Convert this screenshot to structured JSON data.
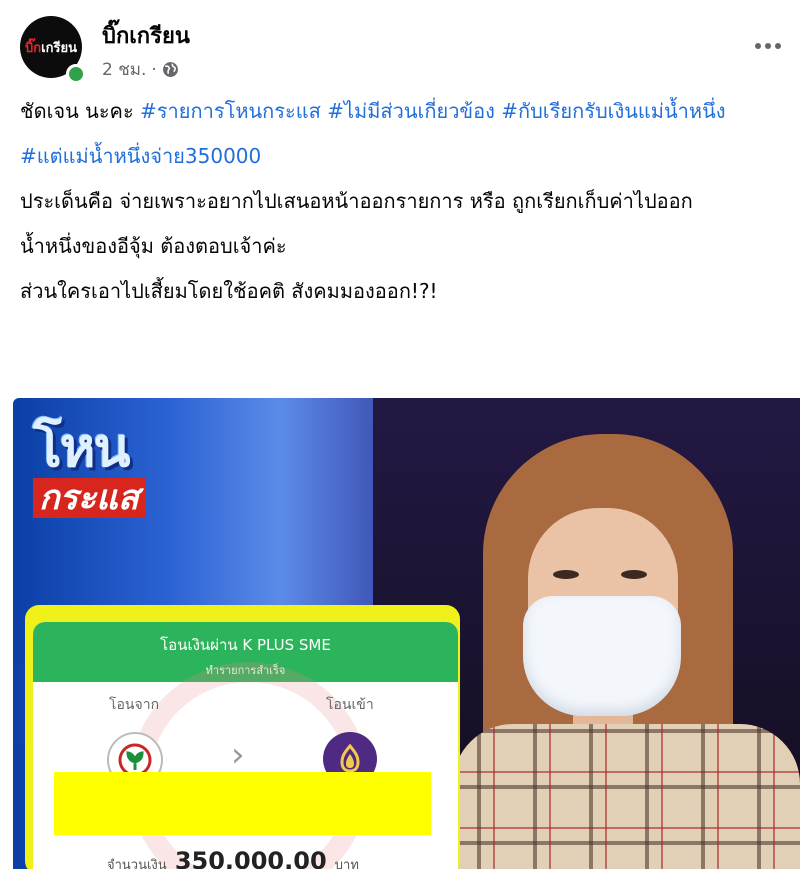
{
  "post": {
    "page_name": "บิ๊กเกรียน",
    "avatar_text_red": "บิ๊ก",
    "avatar_text_white": "เกรียน",
    "time": "2 ชม.",
    "separator": "·",
    "privacy_icon": "globe-icon",
    "more_icon": "more-options-icon"
  },
  "text": {
    "line1_prefix": "ชัดเจน นะคะ  ",
    "tag1": "#รายการโหนกระแส",
    "tag2": "#ไม่มีส่วนเกี่ยวข้อง",
    "tag3": "#กับเรียกรับเงินแม่น้ำหนึ่ง",
    "tag4": "#แต่แม่น้ำหนึ่งจ่าย350000",
    "p3": "ประเด็นคือ จ่ายเพราะอยากไปเสนอหน้าออกรายการ หรือ ถูกเรียกเก็บค่าไปออก",
    "p4": "น้ำหนึ่งของอีจุ้ม  ต้องตอบเจ้าค่ะ",
    "p5": "ส่วนใครเอาไปเสี้ยมโดยใช้อคติ  สังคมมองออก!?!"
  },
  "image": {
    "logo_top": "โหน",
    "logo_bottom": "กระแส",
    "slip": {
      "title": "โอนเงินผ่าน K PLUS SME",
      "subtitle": "ทำรายการสำเร็จ",
      "from_label": "โอนจาก",
      "to_label": "โอนเข้า",
      "arrow": "›",
      "amount_label": "จำนวนเงิน",
      "amount": "350,000.00",
      "currency": "บาท"
    }
  },
  "colors": {
    "link": "#216fdb",
    "online": "#31a24c",
    "slip_green": "#2bb45b",
    "redaction": "#ffff00"
  }
}
